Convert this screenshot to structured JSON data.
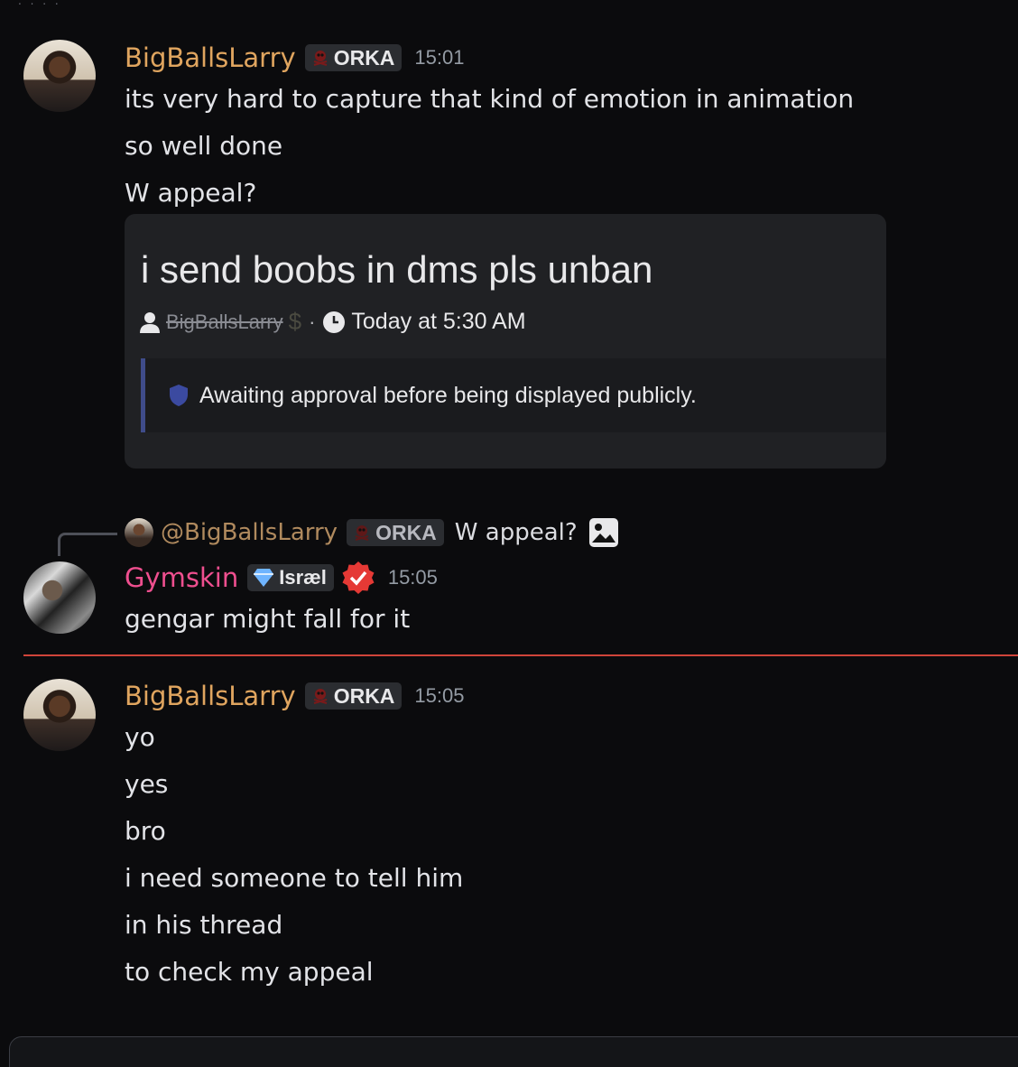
{
  "messages": [
    {
      "author": "BigBallsLarry",
      "role": "ORKA",
      "time": "15:01",
      "lines": [
        "its very hard to capture that kind of emotion in animation",
        "so well done",
        "W appeal?"
      ]
    },
    {
      "author": "Gymskin",
      "badge": "Isræl",
      "time": "15:05",
      "lines": [
        "gengar might fall for it"
      ]
    },
    {
      "author": "BigBallsLarry",
      "role": "ORKA",
      "time": "15:05",
      "lines": [
        "yo",
        "yes",
        "bro",
        "i need someone to tell him",
        "in his thread",
        "to check my appeal"
      ]
    }
  ],
  "embed": {
    "title": "i send boobs in dms pls unban",
    "author": "BigBallsLarry",
    "separator": "·",
    "timestamp": "Today at 5:30 AM",
    "notice": "Awaiting approval before being displayed publicly."
  },
  "reply": {
    "mention": "@BigBallsLarry",
    "role": "ORKA",
    "text": "W appeal?"
  },
  "colors": {
    "background": "#0b0b0d",
    "username_larry": "#e0a55f",
    "username_gymskin": "#ef4f8f",
    "new_messages_divider": "#d0443a",
    "embed_bg": "#202124"
  },
  "icons": [
    "skull-role-icon",
    "user-icon",
    "dollar-icon",
    "clock-icon",
    "shield-icon",
    "image-icon",
    "diamond-icon",
    "verified-icon"
  ]
}
